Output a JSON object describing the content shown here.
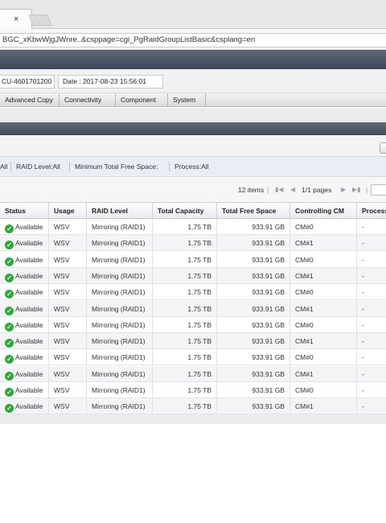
{
  "browser": {
    "tab_close": "×",
    "url": "BGC_xKbwWjgJWnre..&csppage=cgi_PgRaidGroupListBasic&csplang=en"
  },
  "info": {
    "serial": "CU-4601701200",
    "date": "Date : 2017-08-23 15:56:01"
  },
  "menu": [
    "Advanced Copy",
    "Connectivity",
    "Component",
    "System"
  ],
  "filters": {
    "all": "All",
    "raid_level": "RAID Level:All",
    "min_free": "Minimum Total Free Space:",
    "process": "Process:All"
  },
  "pager": {
    "items": "12 items",
    "sep1": "|",
    "pages": "1/1 pages",
    "sep2": "|"
  },
  "table": {
    "columns": [
      "Status",
      "Usage",
      "RAID Level",
      "Total Capacity",
      "Total Free Space",
      "Controlling CM",
      "Process"
    ],
    "rows": [
      [
        "Available",
        "WSV",
        "Mirroring (RAID1)",
        "1.75 TB",
        "933.91 GB",
        "CM#0",
        "-"
      ],
      [
        "Available",
        "WSV",
        "Mirroring (RAID1)",
        "1.75 TB",
        "933.91 GB",
        "CM#1",
        "-"
      ],
      [
        "Available",
        "WSV",
        "Mirroring (RAID1)",
        "1.75 TB",
        "933.91 GB",
        "CM#0",
        "-"
      ],
      [
        "Available",
        "WSV",
        "Mirroring (RAID1)",
        "1.75 TB",
        "933.91 GB",
        "CM#1",
        "-"
      ],
      [
        "Available",
        "WSV",
        "Mirroring (RAID1)",
        "1.75 TB",
        "933.91 GB",
        "CM#0",
        "-"
      ],
      [
        "Available",
        "WSV",
        "Mirroring (RAID1)",
        "1.75 TB",
        "933.91 GB",
        "CM#1",
        "-"
      ],
      [
        "Available",
        "WSV",
        "Mirroring (RAID1)",
        "1.75 TB",
        "933.91 GB",
        "CM#0",
        "-"
      ],
      [
        "Available",
        "WSV",
        "Mirroring (RAID1)",
        "1.75 TB",
        "933.91 GB",
        "CM#1",
        "-"
      ],
      [
        "Available",
        "WSV",
        "Mirroring (RAID1)",
        "1.75 TB",
        "933.91 GB",
        "CM#0",
        "-"
      ],
      [
        "Available",
        "WSV",
        "Mirroring (RAID1)",
        "1.75 TB",
        "933.91 GB",
        "CM#1",
        "-"
      ],
      [
        "Available",
        "WSV",
        "Mirroring (RAID1)",
        "1.75 TB",
        "933.91 GB",
        "CM#0",
        "-"
      ],
      [
        "Available",
        "WSV",
        "Mirroring (RAID1)",
        "1.75 TB",
        "933.91 GB",
        "CM#1",
        "-"
      ]
    ]
  },
  "colors": {
    "status_ok": "#2fa83a",
    "header_bar": "#4a5463"
  },
  "icons": {
    "status": "check-circle-icon",
    "first": "first-page-icon",
    "prev": "prev-page-icon",
    "next": "next-page-icon",
    "last": "last-page-icon"
  }
}
